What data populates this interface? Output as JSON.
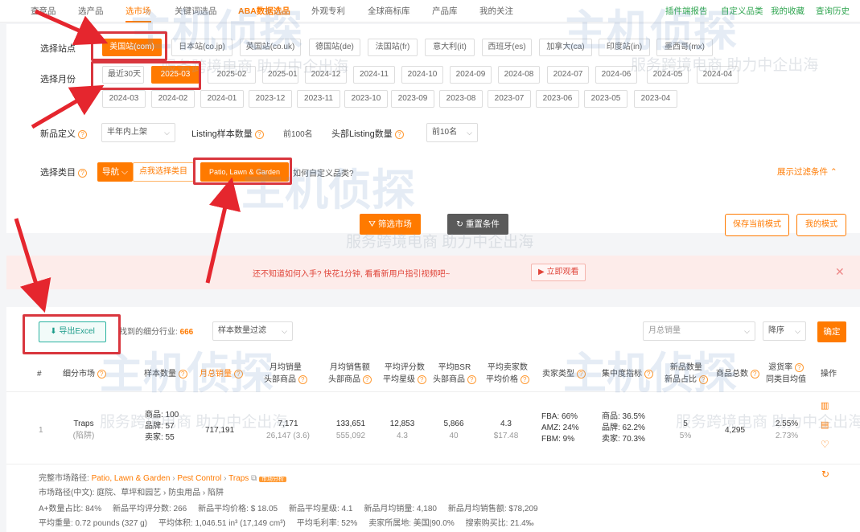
{
  "topnav": {
    "items": [
      "查竞品",
      "选产品",
      "选市场",
      "关键词选品",
      "ABA数据选品",
      "外观专利",
      "全球商标库",
      "产品库",
      "我的关注"
    ],
    "right_items": [
      "插件端报告",
      "自定义品类",
      "我的收藏",
      "查询历史"
    ]
  },
  "filters": {
    "site_label": "选择站点",
    "sites": [
      "美国站(com)",
      "日本站(co.jp)",
      "英国站(co.uk)",
      "德国站(de)",
      "法国站(fr)",
      "意大利(it)",
      "西班牙(es)",
      "加拿大(ca)",
      "印度站(in)",
      "墨西哥(mx)"
    ],
    "month_label": "选择月份",
    "months_row1": [
      "最近30天",
      "2025-03",
      "2025-02",
      "2025-01",
      "2024-12",
      "2024-11",
      "2024-10",
      "2024-09",
      "2024-08",
      "2024-07",
      "2024-06",
      "2024-05",
      "2024-04"
    ],
    "months_row2": [
      "2024-03",
      "2024-02",
      "2024-01",
      "2023-12",
      "2023-11",
      "2023-10",
      "2023-09",
      "2023-08",
      "2023-07",
      "2023-06",
      "2023-05",
      "2023-04"
    ],
    "newprod_label": "新品定义",
    "newprod_value": "半年内上架",
    "listing_label": "Listing样本数量",
    "listing_value": "前100名",
    "head_label": "头部Listing数量",
    "head_value": "前10名",
    "category_label": "选择类目",
    "nav_btn": "导航",
    "pick_btn": "点我选择类目",
    "category_value": "Patio, Lawn & Garden",
    "custom_q": "如何自定义品类?",
    "expand": "展示过滤条件",
    "filter_btn": "筛选市场",
    "reset_btn": "重置条件",
    "save_mode": "保存当前模式",
    "my_mode": "我的模式"
  },
  "notice": {
    "text": "还不知道如何入手? 快花1分钟, 看看新用户指引视频吧~",
    "watch": "立即观看"
  },
  "results": {
    "export_btn": "导出Excel",
    "found_label": "找到的细分行业:",
    "found_count": "666",
    "sample_filter": "样本数量过滤",
    "sort_field": "月总销量",
    "sort_order": "降序",
    "confirm": "确定",
    "headers": {
      "idx": "#",
      "market": "细分市场",
      "sample": "样本数量",
      "monthly_sales": "月总销量",
      "avg_sales": [
        "月均销量",
        "头部商品"
      ],
      "avg_revenue": [
        "月均销售额",
        "头部商品"
      ],
      "avg_reviews": [
        "平均评分数",
        "平均星级"
      ],
      "avg_bsr": [
        "平均BSR",
        "头部商品"
      ],
      "avg_sellers": [
        "平均卖家数",
        "平均价格"
      ],
      "seller_type": "卖家类型",
      "concentration": "集中度指标",
      "new_count": [
        "新品数量",
        "新品占比"
      ],
      "total_products": "商品总数",
      "return_rate": [
        "退货率",
        "同类目均值"
      ],
      "action": "操作"
    },
    "row": {
      "idx": "1",
      "name": "Traps",
      "name_cn": "(陷阱)",
      "sample": [
        "商品: 100",
        "品牌: 57",
        "卖家: 55"
      ],
      "monthly_sales": "717,191",
      "avg_sales": "7,171",
      "avg_sales_head": "26,147 (3.6)",
      "avg_revenue": "133,651",
      "avg_revenue_head": "555,092",
      "avg_reviews": "12,853",
      "avg_stars": "4.3",
      "avg_bsr": "5,866",
      "avg_bsr_head": "40",
      "avg_sellers": "4.3",
      "avg_price": "$17.48",
      "seller_type": [
        "FBA: 66%",
        "AMZ: 24%",
        "FBM: 9%"
      ],
      "concentration": [
        "商品: 36.5%",
        "品牌: 62.2%",
        "卖家: 70.3%"
      ],
      "new_count": "5",
      "new_ratio": "5%",
      "total_products": "4,295",
      "return_rate": "2.55%",
      "return_avg": "2.73%"
    },
    "detail": {
      "path_label": "完整市场路径:",
      "path": [
        "Patio, Lawn & Garden",
        "Pest Control",
        "Traps"
      ],
      "path_badge": "市场分析",
      "path_cn_label": "市场路径(中文):",
      "path_cn": "庭院、草坪和园艺 › 防虫用品 › 陷阱",
      "line3": [
        "A+数量占比: 84%",
        "新品平均评分数: 266",
        "新品平均价格: $ 18.05",
        "新品平均星级: 4.1",
        "新品月均销量: 4,180",
        "新品月均销售额: $78,209"
      ],
      "line4": [
        "平均重量: 0.72 pounds (327 g)",
        "平均体积: 1,046.51 in³ (17,149 cm³)",
        "平均毛利率: 52%",
        "卖家所属地: 美国|90.0%",
        "搜索购买比: 21.4‰"
      ]
    }
  },
  "watermark": {
    "brand": "主机侦探",
    "slogan": "服务跨境电商  助力中企出海"
  }
}
